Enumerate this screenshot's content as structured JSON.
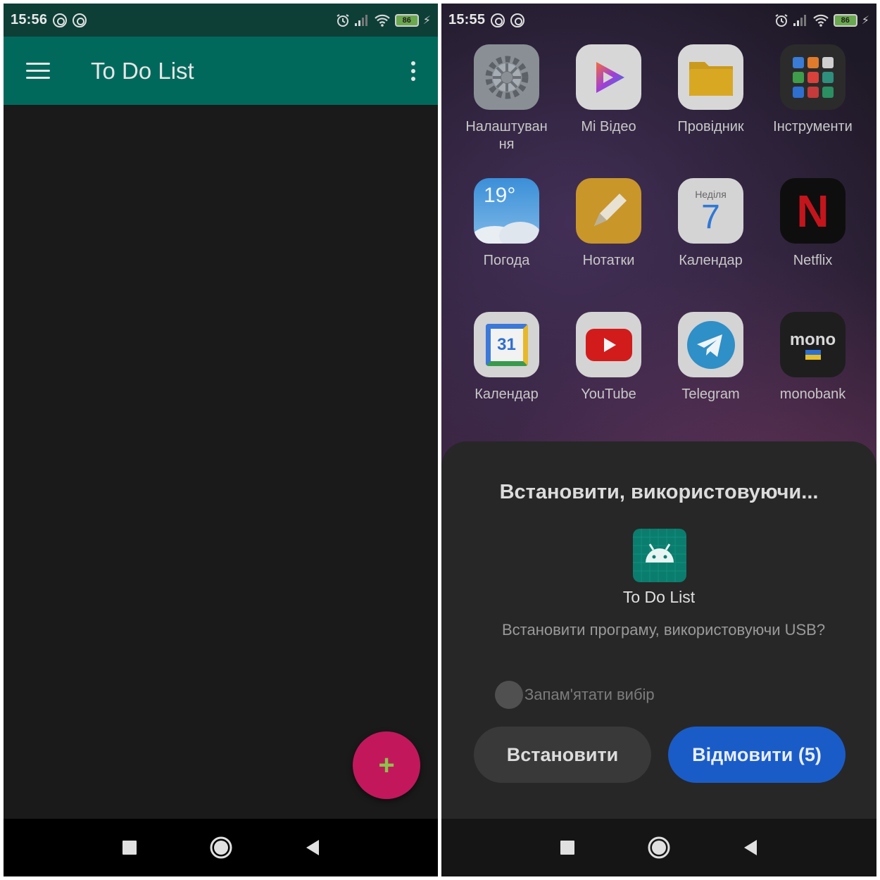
{
  "left": {
    "status": {
      "time": "15:56",
      "battery": "86"
    },
    "appbar": {
      "title": "To Do List"
    },
    "fab": {
      "symbol": "+"
    }
  },
  "right": {
    "status": {
      "time": "15:55",
      "battery": "86"
    },
    "apps": [
      {
        "label": "Налаштуван\nня",
        "icon": "settings-icon"
      },
      {
        "label": "Mi Відео",
        "icon": "mi-video-icon"
      },
      {
        "label": "Провідник",
        "icon": "file-manager-icon"
      },
      {
        "label": "Інструменти",
        "icon": "tools-folder-icon"
      },
      {
        "label": "Погода",
        "icon": "weather-icon",
        "text": "19°"
      },
      {
        "label": "Нотатки",
        "icon": "notes-icon"
      },
      {
        "label": "Календар",
        "icon": "calendar-icon",
        "day_name": "Неділя",
        "day": "7"
      },
      {
        "label": "Netflix",
        "icon": "netflix-icon",
        "text": "N"
      },
      {
        "label": "Календар",
        "icon": "google-calendar-icon",
        "text": "31"
      },
      {
        "label": "YouTube",
        "icon": "youtube-icon"
      },
      {
        "label": "Telegram",
        "icon": "telegram-icon"
      },
      {
        "label": "monobank",
        "icon": "monobank-icon",
        "text": "mono"
      }
    ],
    "dialog": {
      "title": "Встановити, використовуючи...",
      "app_name": "To Do List",
      "message": "Встановити програму, використовуючи USB?",
      "remember_label": "Запам'ятати вибір",
      "install_label": "Встановити",
      "cancel_label": "Відмовити (5)"
    }
  },
  "colors": {
    "appbar": "#00695c",
    "fab": "#c2185b",
    "fab_plus": "#8bc34a",
    "cancel_button": "#1a5cc7"
  }
}
